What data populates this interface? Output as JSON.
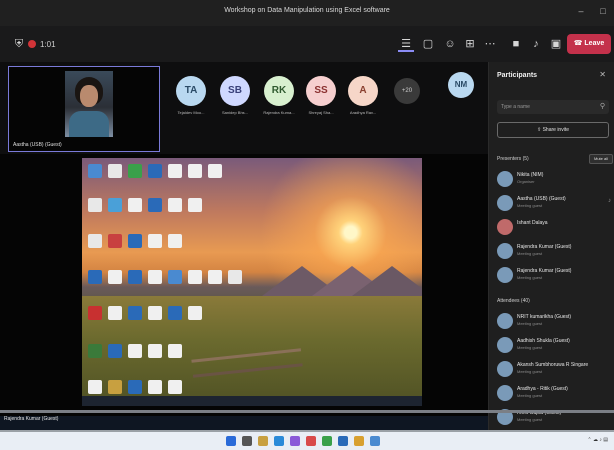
{
  "window": {
    "title": "Workshop on Data Manipulation using Excel software"
  },
  "toolbar": {
    "timer": "1:01",
    "leave_label": "Leave"
  },
  "self_tile": {
    "name": "Aastha (USB) (Guest)"
  },
  "avatars": [
    {
      "initials": "TA",
      "name": "Tejaldev Moo...",
      "bg": "#b9d8f0",
      "fg": "#2a4a66"
    },
    {
      "initials": "SB",
      "name": "Sanidep Bhs...",
      "bg": "#cfd8ff",
      "fg": "#39407a"
    },
    {
      "initials": "RK",
      "name": "Rajendra Kuma...",
      "bg": "#d8f0cf",
      "fg": "#2f5a2f"
    },
    {
      "initials": "SS",
      "name": "Shreyaj Sha...",
      "bg": "#f6cfcf",
      "fg": "#8a3030"
    },
    {
      "initials": "A",
      "name": "Aradhya Rav...",
      "bg": "#f6d6c8",
      "fg": "#8a4030"
    },
    {
      "initials": "NM",
      "name": "",
      "bg": "#b9d8f0",
      "fg": "#2a4a66"
    }
  ],
  "more_count": "+20",
  "presenter_label": "Rajendra Kumar (Guest)",
  "panel": {
    "title": "Participants",
    "search_placeholder": "Type a name",
    "share_invite": "Share invite",
    "presenters_head": "Presenters (5)",
    "mute_all": "Mute all",
    "attendees_head": "Attendees (40)",
    "presenters": [
      {
        "name": "Nikita (NIM)",
        "role": "Organiser"
      },
      {
        "name": "Aastha (USB) (Guest)",
        "role": "Meeting guest"
      },
      {
        "name": "Ishant Dalaya",
        "role": ""
      },
      {
        "name": "Rajendra Kumar (Guest)",
        "role": "Meeting guest"
      },
      {
        "name": "Rajendra Kumar (Guest)",
        "role": "Meeting guest"
      }
    ],
    "attendees": [
      {
        "name": "NRIT kumarikha (Guest)",
        "role": "Meeting guest"
      },
      {
        "name": "Aadhish Shukla (Guest)",
        "role": "Meeting guest"
      },
      {
        "name": "Akansh Sumbhoruwa R Singare",
        "role": "Meeting guest"
      },
      {
        "name": "Aradhya - Ritik (Guest)",
        "role": "Meeting guest"
      },
      {
        "name": "Ankit Gupta (Guest)",
        "role": "Meeting guest"
      }
    ]
  }
}
